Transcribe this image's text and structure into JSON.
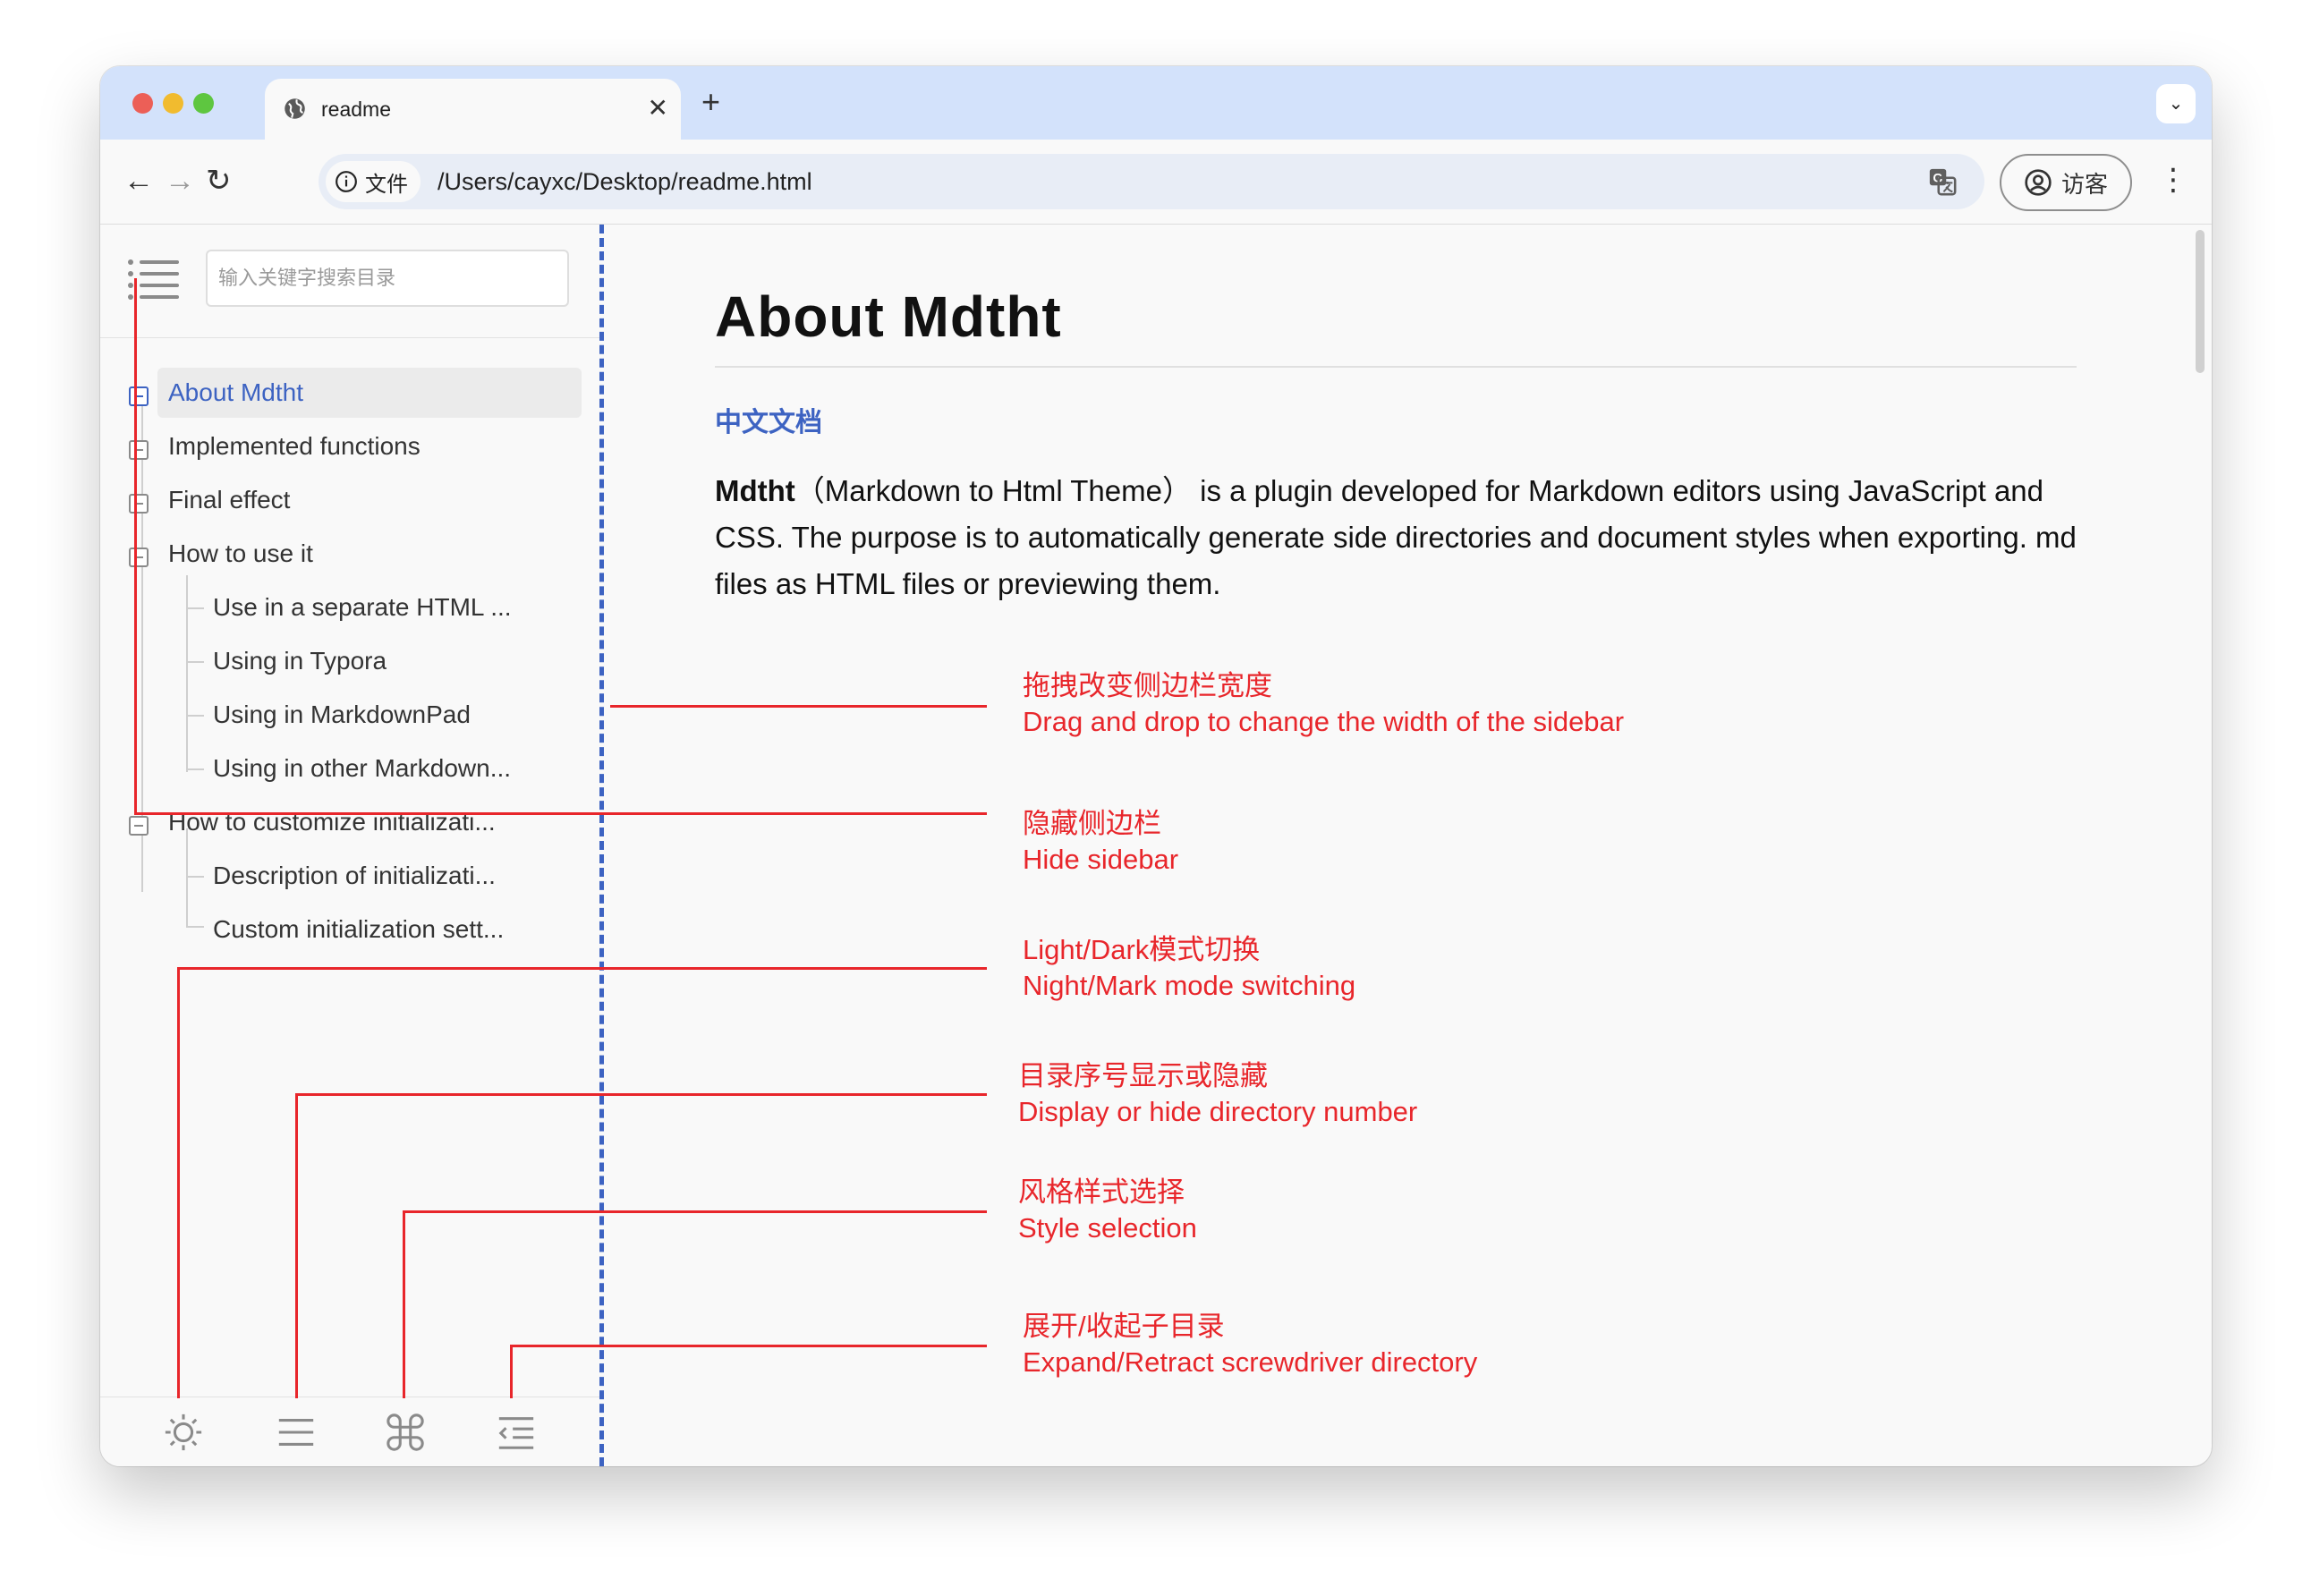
{
  "browser": {
    "tab_title": "readme",
    "omnibox_chip": "文件",
    "url": "/Users/cayxc/Desktop/readme.html",
    "profile_label": "访客",
    "traffic_light_colors": [
      "#ec5f57",
      "#f1bb2f",
      "#5ec640"
    ]
  },
  "sidebar": {
    "search_placeholder": "输入关键字搜索目录",
    "toc": [
      {
        "label": "About Mdtht",
        "level": 1,
        "active": true
      },
      {
        "label": "Implemented functions",
        "level": 1
      },
      {
        "label": "Final effect",
        "level": 1
      },
      {
        "label": "How to use it",
        "level": 1
      },
      {
        "label": "Use in a separate HTML ...",
        "level": 2
      },
      {
        "label": "Using in Typora",
        "level": 2
      },
      {
        "label": "Using in MarkdownPad",
        "level": 2
      },
      {
        "label": "Using in other Markdown...",
        "level": 2
      },
      {
        "label": "How to customize initializati...",
        "level": 1
      },
      {
        "label": "Description of initializati...",
        "level": 2
      },
      {
        "label": "Custom initialization sett...",
        "level": 2
      }
    ],
    "bottom_icons": [
      "sun-icon",
      "list-icon",
      "command-icon",
      "indent-icon"
    ]
  },
  "article": {
    "title": "About Mdtht",
    "cn_link": "中文文档",
    "intro_bold": "Mdtht",
    "intro_rest": "（Markdown to Html Theme） is a plugin developed for Markdown editors using JavaScript and CSS. The purpose is to automatically generate side directories and document styles when exporting. md files as HTML files or previewing them."
  },
  "annotations": [
    {
      "cn": "拖拽改变侧边栏宽度",
      "en": "Drag and drop to change the width of the sidebar"
    },
    {
      "cn": "隐藏侧边栏",
      "en": "Hide sidebar"
    },
    {
      "cn": "Light/Dark模式切换",
      "en": "Night/Mark mode switching"
    },
    {
      "cn": "目录序号显示或隐藏",
      "en": "Display or hide directory number"
    },
    {
      "cn": "风格样式选择",
      "en": "Style selection"
    },
    {
      "cn": "展开/收起子目录",
      "en": "Expand/Retract screwdriver directory"
    }
  ],
  "colors": {
    "accent": "#3d63c2",
    "annotation": "#e8262b",
    "tabstrip": "#d3e2fb"
  }
}
